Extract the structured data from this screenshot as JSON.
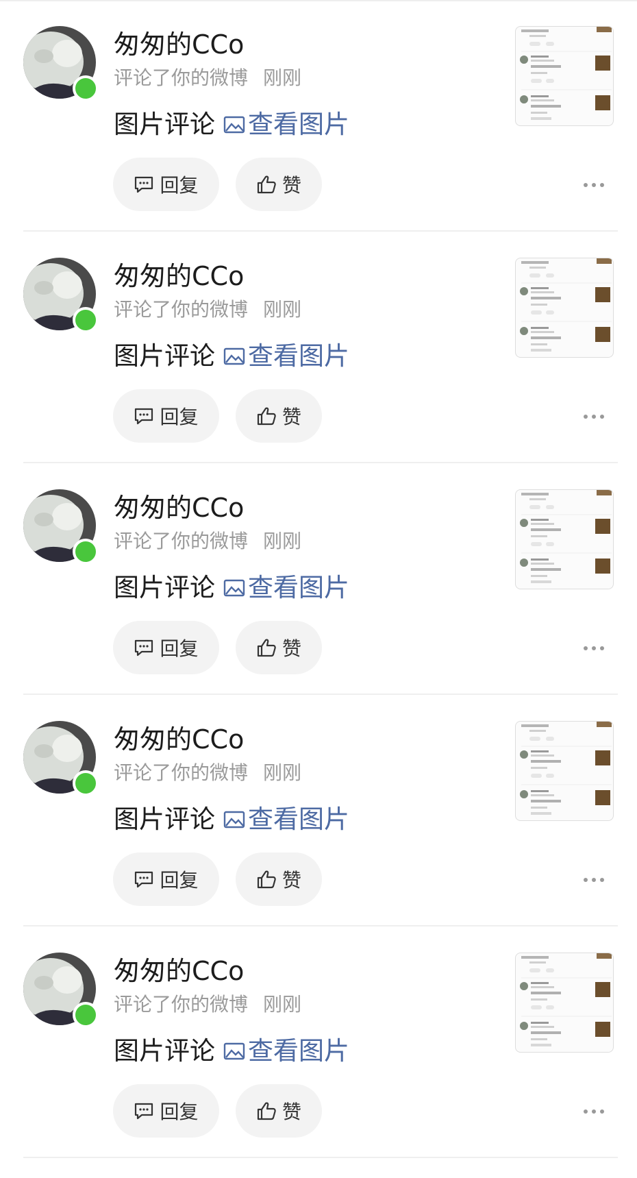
{
  "notifications": [
    {
      "username": "匆匆的CCo",
      "action": "评论了你的微博",
      "time": "刚刚",
      "comment": "图片评论",
      "view_link": "查看图片",
      "reply_label": "回复",
      "like_label": "赞"
    },
    {
      "username": "匆匆的CCo",
      "action": "评论了你的微博",
      "time": "刚刚",
      "comment": "图片评论",
      "view_link": "查看图片",
      "reply_label": "回复",
      "like_label": "赞"
    },
    {
      "username": "匆匆的CCo",
      "action": "评论了你的微博",
      "time": "刚刚",
      "comment": "图片评论",
      "view_link": "查看图片",
      "reply_label": "回复",
      "like_label": "赞"
    },
    {
      "username": "匆匆的CCo",
      "action": "评论了你的微博",
      "time": "刚刚",
      "comment": "图片评论",
      "view_link": "查看图片",
      "reply_label": "回复",
      "like_label": "赞"
    },
    {
      "username": "匆匆的CCo",
      "action": "评论了你的微博",
      "time": "刚刚",
      "comment": "图片评论",
      "view_link": "查看图片",
      "reply_label": "回复",
      "like_label": "赞"
    }
  ],
  "icons": {
    "reply": "comment-bubble-icon",
    "like": "thumbs-up-icon",
    "view": "image-icon",
    "more": "more-dots-icon"
  },
  "colors": {
    "link": "#4d6aa3",
    "online": "#49c63c",
    "secondary_text": "#9a9a9a",
    "button_bg": "#f3f3f3"
  }
}
